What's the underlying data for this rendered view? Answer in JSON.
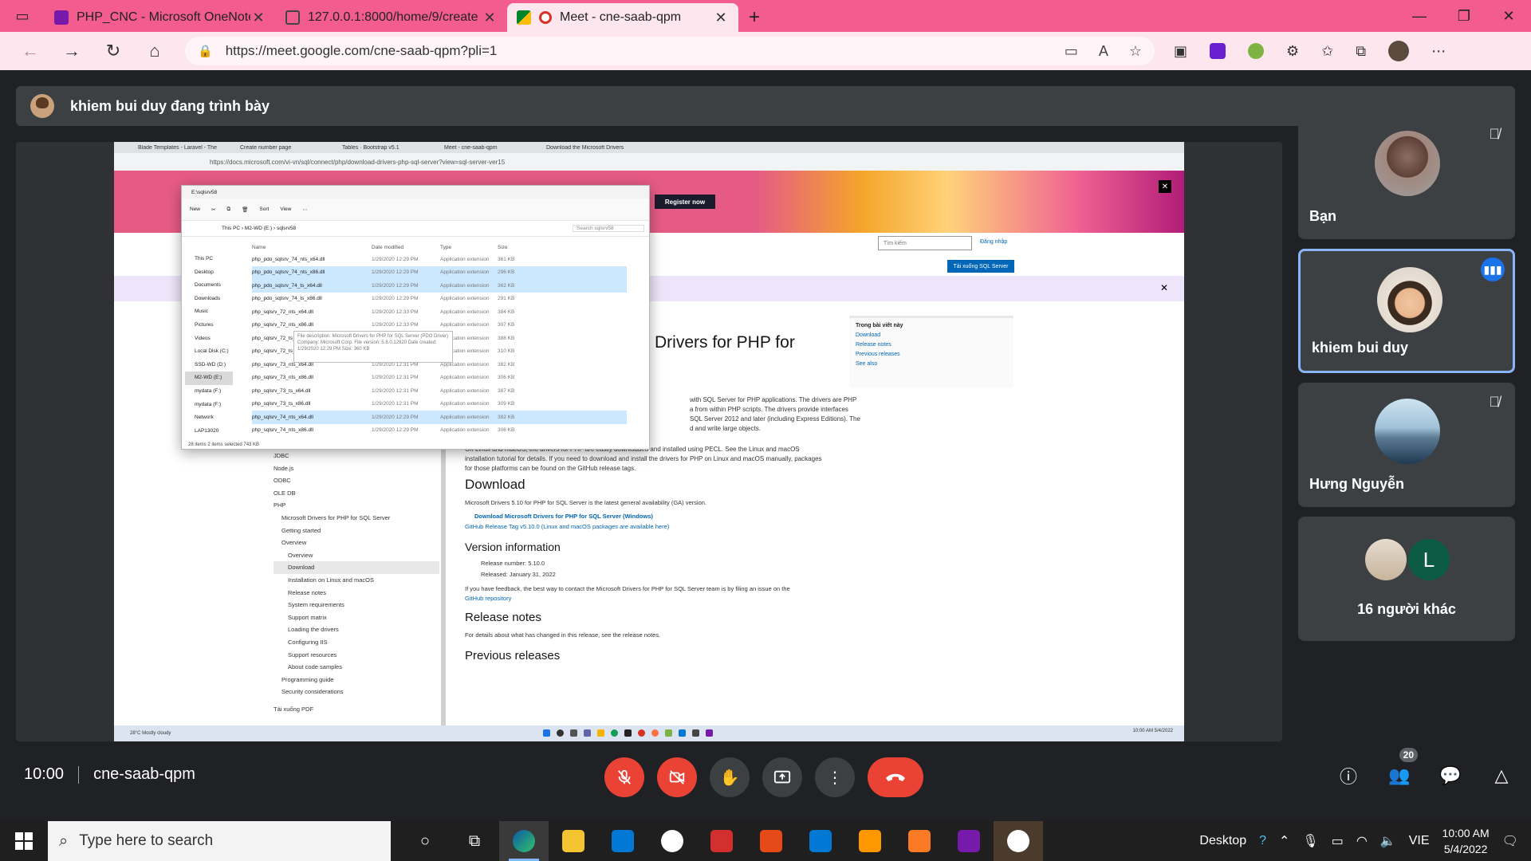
{
  "browser": {
    "tabs": [
      {
        "label": "PHP_CNC - Microsoft OneNote O",
        "icon": "onenote-icon",
        "color": "#7719aa"
      },
      {
        "label": "127.0.0.1:8000/home/9/create",
        "icon": "page-icon",
        "color": "#555555"
      },
      {
        "label": "Meet - cne-saab-qpm",
        "icon": "meet-icon",
        "color": "#00832d"
      }
    ],
    "url": "https://meet.google.com/cne-saab-qpm?pli=1"
  },
  "meet": {
    "presenting_text": "khiem bui duy đang trình bày",
    "time": "10:00",
    "meeting_code": "cne-saab-qpm",
    "participants_count": "20",
    "tiles": [
      {
        "name": "Bạn",
        "muted": true
      },
      {
        "name": "khiem bui duy",
        "speaking": true
      },
      {
        "name": "Hưng Nguyễn",
        "muted": true
      }
    ],
    "others_label": "16 người khác",
    "others_initial": "L"
  },
  "shared_screen": {
    "tabs": [
      "Blade Templates - Laravel - The",
      "Create number page",
      "Tables · Bootstrap v5.1",
      "Meet - cne-saab-qpm",
      "Download the Microsoft Drivers"
    ],
    "url": "https://docs.microsoft.com/vi-vn/sql/connect/php/download-drivers-php-sql-server?view=sql-server-ver15",
    "register_btn": "Register now",
    "search_placeholder": "Tìm kiếm",
    "login": "Đăng nhập",
    "download_btn": "Tải xuống SQL Server",
    "page_title": "Drivers for PHP for",
    "toc_title": "Trong bài viết này",
    "toc_links": [
      "Download",
      "Release notes",
      "Previous releases",
      "See also"
    ],
    "intro_lines": [
      "with SQL Server for PHP applications. The drivers are PHP",
      "a from within PHP scripts. The drivers provide interfaces",
      "SQL Server 2012 and later (including Express Editions). The",
      "d and write large objects."
    ],
    "linux_text": "On Linux and macOS, the drivers for PHP are easily downloaded and installed using PECL. See the Linux and macOS installation tutorial for details. If you need to download and install the drivers for PHP on Linux and macOS manually, packages for those platforms can be found on the GitHub release tags.",
    "download_heading": "Download",
    "download_text": "Microsoft Drivers 5.10 for PHP for SQL Server is the latest general availability (GA) version.",
    "download_link": "Download Microsoft Drivers for PHP for SQL Server (Windows)",
    "github_link": "GitHub Release Tag v5.10.0 (Linux and macOS packages are available here)",
    "version_heading": "Version information",
    "version_items": [
      "Release number: 5.10.0",
      "Released: January 31, 2022"
    ],
    "feedback_text": "If you have feedback, the best way to contact the Microsoft Drivers for PHP for SQL Server team is by filing an issue on the",
    "feedback_link": "GitHub repository",
    "release_heading": "Release notes",
    "release_text": "For details about what has changed in this release, see the release notes.",
    "previous_heading": "Previous releases",
    "sidenav": [
      "JDBC",
      "Node.js",
      "ODBC",
      "OLE DB",
      "PHP",
      "Microsoft Drivers for PHP for SQL Server",
      "Getting started",
      "Overview",
      "Overview",
      "Download",
      "Installation on Linux and macOS",
      "Release notes",
      "System requirements",
      "Support matrix",
      "Loading the drivers",
      "Configuring IIS",
      "Support resources",
      "About code samples",
      "Programming guide",
      "Security considerations"
    ],
    "pdf_link": "Tải xuống PDF",
    "weather": "28°C Mostly cloudy",
    "tray_time": "10:00 AM 5/4/2022"
  },
  "explorer": {
    "title": "E:\\sqlsrv58",
    "toolbar": [
      "New",
      "Sort",
      "View"
    ],
    "path": "This PC › M2-WD (E:) › sqlsrv58",
    "search_placeholder": "Search sqlsrv58",
    "nav": [
      "This PC",
      "Desktop",
      "Documents",
      "Downloads",
      "Music",
      "Pictures",
      "Videos",
      "Local Disk (C:)",
      "SSD-WD (D:)",
      "M2-WD (E:)",
      "mydata (F:)",
      "mydata (F:)",
      "Network",
      "LAP13020"
    ],
    "headers": [
      "Name",
      "Date modified",
      "Type",
      "Size"
    ],
    "files": [
      {
        "name": "php_pdo_sqlsrv_74_nts_x64.dll",
        "date": "1/29/2020 12:29 PM",
        "type": "Application extension",
        "size": "361 KB"
      },
      {
        "name": "php_pdo_sqlsrv_74_nts_x86.dll",
        "date": "1/29/2020 12:29 PM",
        "type": "Application extension",
        "size": "296 KB",
        "sel": true
      },
      {
        "name": "php_pdo_sqlsrv_74_ts_x64.dll",
        "date": "1/29/2020 12:29 PM",
        "type": "Application extension",
        "size": "362 KB",
        "sel": true
      },
      {
        "name": "php_pdo_sqlsrv_74_ts_x86.dll",
        "date": "1/29/2020 12:29 PM",
        "type": "Application extension",
        "size": "291 KB"
      },
      {
        "name": "php_sqlsrv_72_nts_x64.dll",
        "date": "1/29/2020 12:33 PM",
        "type": "Application extension",
        "size": "384 KB"
      },
      {
        "name": "php_sqlsrv_72_nts_x86.dll",
        "date": "1/29/2020 12:33 PM",
        "type": "Application extension",
        "size": "307 KB"
      },
      {
        "name": "php_sqlsrv_72_ts_x64.dll",
        "date": "1/29/2020 12:33 PM",
        "type": "Application extension",
        "size": "388 KB"
      },
      {
        "name": "php_sqlsrv_72_ts_x86.dll",
        "date": "1/29/2020 12:33 PM",
        "type": "Application extension",
        "size": "310 KB"
      },
      {
        "name": "php_sqlsrv_73_nts_x64.dll",
        "date": "1/29/2020 12:31 PM",
        "type": "Application extension",
        "size": "382 KB"
      },
      {
        "name": "php_sqlsrv_73_nts_x86.dll",
        "date": "1/29/2020 12:31 PM",
        "type": "Application extension",
        "size": "306 KB"
      },
      {
        "name": "php_sqlsrv_73_ts_x64.dll",
        "date": "1/29/2020 12:31 PM",
        "type": "Application extension",
        "size": "387 KB"
      },
      {
        "name": "php_sqlsrv_73_ts_x86.dll",
        "date": "1/29/2020 12:31 PM",
        "type": "Application extension",
        "size": "309 KB"
      },
      {
        "name": "php_sqlsrv_74_nts_x64.dll",
        "date": "1/29/2020 12:29 PM",
        "type": "Application extension",
        "size": "382 KB",
        "sel": true
      },
      {
        "name": "php_sqlsrv_74_nts_x86.dll",
        "date": "1/29/2020 12:29 PM",
        "type": "Application extension",
        "size": "306 KB"
      }
    ],
    "tooltip": "File description: Microsoft Drivers for PHP for SQL Server (PDO Driver) Company: Microsoft Corp. File version: 5.8.0.12920 Date created: 1/29/2020 12:29 PM Size: 360 KB",
    "status": "28 items   2 items selected  743 KB"
  },
  "taskbar": {
    "search_placeholder": "Type here to search",
    "desktop_label": "Desktop",
    "lang": "VIE",
    "time": "10:00 AM",
    "date": "5/4/2022"
  }
}
